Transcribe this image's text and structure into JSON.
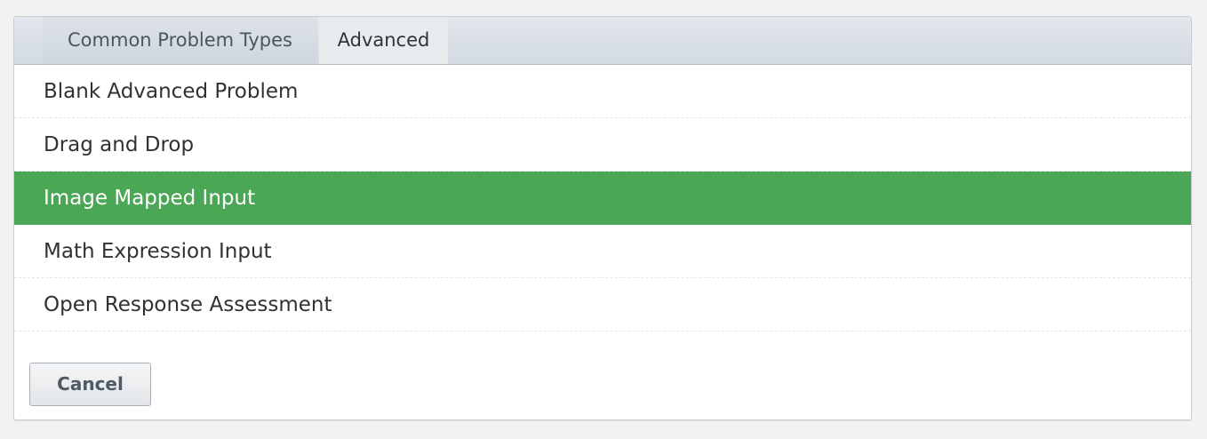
{
  "tabs": [
    {
      "label": "Common Problem Types",
      "active": false
    },
    {
      "label": "Advanced",
      "active": true
    }
  ],
  "items": [
    {
      "label": "Blank Advanced Problem",
      "selected": false
    },
    {
      "label": "Drag and Drop",
      "selected": false
    },
    {
      "label": "Image Mapped Input",
      "selected": true
    },
    {
      "label": "Math Expression Input",
      "selected": false
    },
    {
      "label": "Open Response Assessment",
      "selected": false
    }
  ],
  "cancel_label": "Cancel",
  "colors": {
    "selected_bg": "#4ba756",
    "selected_text": "#ffffff",
    "tabbar_bg": "#d2d9e1"
  }
}
